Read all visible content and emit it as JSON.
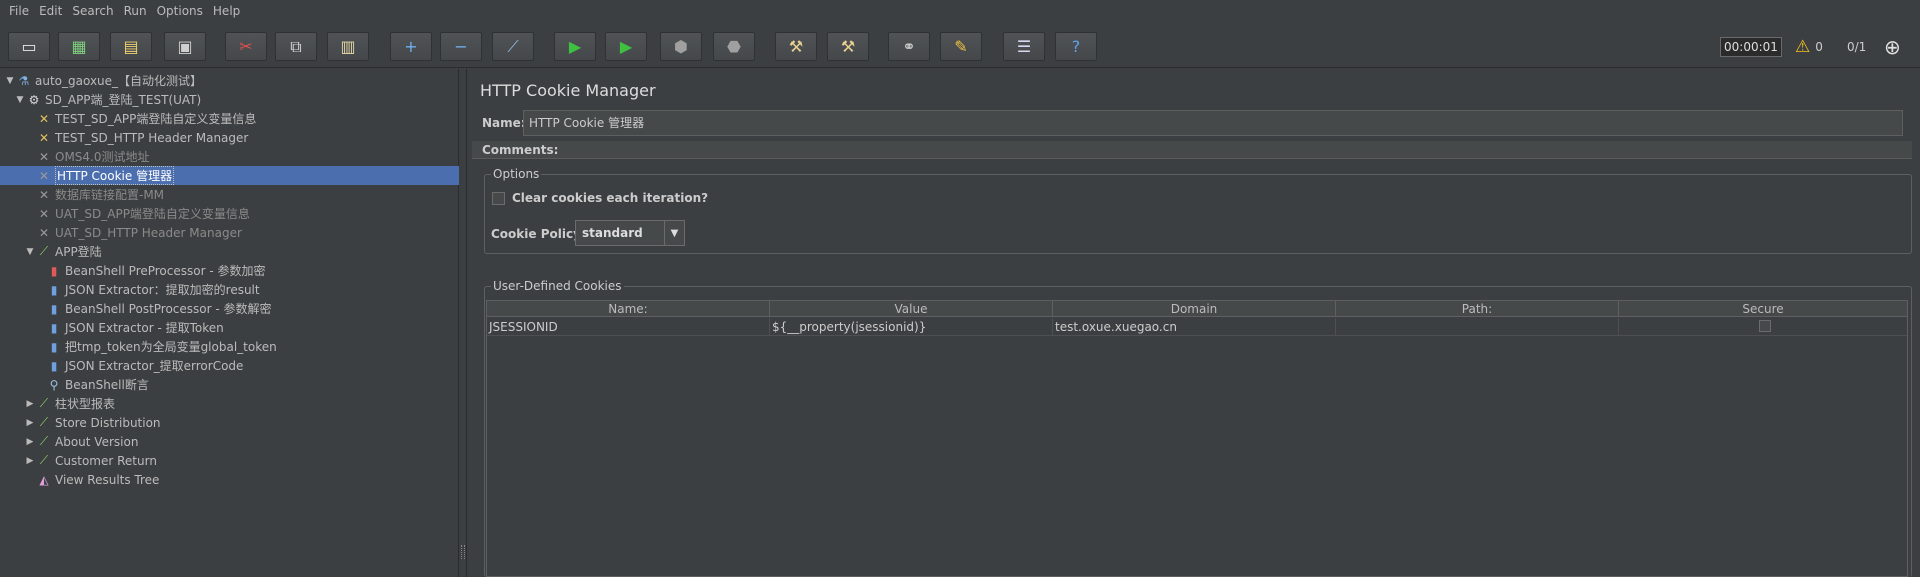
{
  "menu": [
    "File",
    "Edit",
    "Search",
    "Run",
    "Options",
    "Help"
  ],
  "toolbar": {
    "buttons": [
      {
        "name": "new-icon",
        "glyph": "▭"
      },
      {
        "name": "templates-icon",
        "glyph": "▦"
      },
      {
        "name": "open-icon",
        "glyph": "▤"
      },
      {
        "name": "save-icon",
        "glyph": "▣"
      },
      {
        "name": "cut-icon",
        "glyph": "✂"
      },
      {
        "name": "copy-icon",
        "glyph": "⧉"
      },
      {
        "name": "paste-icon",
        "glyph": "▥"
      },
      {
        "name": "expand-icon",
        "glyph": "+"
      },
      {
        "name": "collapse-icon",
        "glyph": "−"
      },
      {
        "name": "toggle-icon",
        "glyph": "⟋"
      },
      {
        "name": "start-icon",
        "glyph": "▶"
      },
      {
        "name": "start-no-pause-icon",
        "glyph": "▶"
      },
      {
        "name": "stop-icon",
        "glyph": "⬢"
      },
      {
        "name": "shutdown-icon",
        "glyph": "⬣"
      },
      {
        "name": "clear-icon",
        "glyph": "⚒"
      },
      {
        "name": "clear-all-icon",
        "glyph": "⚒"
      },
      {
        "name": "search-icon",
        "glyph": "⚭"
      },
      {
        "name": "reset-search-icon",
        "glyph": "✎"
      },
      {
        "name": "function-helper-icon",
        "glyph": "☰"
      },
      {
        "name": "help-icon",
        "glyph": "?"
      }
    ],
    "timer": "00:00:01",
    "warning_count": "0",
    "threads": "0/1"
  },
  "tree": [
    {
      "label": "auto_gaoxue_【自动化测试】",
      "level": 0,
      "toggle": "▼",
      "icon": "flask-icon",
      "glyph": "⚗",
      "color": "#7fb2e5",
      "state": "normal"
    },
    {
      "label": "SD_APP端_登陆_TEST(UAT)",
      "level": 1,
      "toggle": "▼",
      "icon": "thread-group-icon",
      "glyph": "⚙",
      "color": "#d9d9d9",
      "state": "normal"
    },
    {
      "label": "TEST_SD_APP端登陆自定义变量信息",
      "level": 2,
      "toggle": "",
      "icon": "config-icon",
      "glyph": "✕",
      "color": "#e0c060",
      "state": "normal"
    },
    {
      "label": "TEST_SD_HTTP Header Manager",
      "level": 2,
      "toggle": "",
      "icon": "config-icon",
      "glyph": "✕",
      "color": "#e0c060",
      "state": "normal"
    },
    {
      "label": "OMS4.0测试地址",
      "level": 2,
      "toggle": "",
      "icon": "config-icon",
      "glyph": "✕",
      "color": "#9a9a9a",
      "state": "disabled"
    },
    {
      "label": "HTTP Cookie 管理器",
      "level": 2,
      "toggle": "",
      "icon": "config-icon",
      "glyph": "✕",
      "color": "#9a9a9a",
      "state": "selected"
    },
    {
      "label": "数据库链接配置-MM",
      "level": 2,
      "toggle": "",
      "icon": "config-icon",
      "glyph": "✕",
      "color": "#9a9a9a",
      "state": "disabled"
    },
    {
      "label": "UAT_SD_APP端登陆自定义变量信息",
      "level": 2,
      "toggle": "",
      "icon": "config-icon",
      "glyph": "✕",
      "color": "#9a9a9a",
      "state": "disabled"
    },
    {
      "label": "UAT_SD_HTTP Header Manager",
      "level": 2,
      "toggle": "",
      "icon": "config-icon",
      "glyph": "✕",
      "color": "#9a9a9a",
      "state": "disabled"
    },
    {
      "label": "APP登陆",
      "level": 2,
      "toggle": "▼",
      "icon": "sampler-icon",
      "glyph": "⟋",
      "color": "#8fd16a",
      "state": "normal"
    },
    {
      "label": "BeanShell PreProcessor - 参数加密",
      "level": 3,
      "toggle": "",
      "icon": "preprocessor-icon",
      "glyph": "▮",
      "color": "#e05a5a",
      "state": "normal"
    },
    {
      "label": "JSON Extractor：提取加密的result",
      "level": 3,
      "toggle": "",
      "icon": "postprocessor-icon",
      "glyph": "▮",
      "color": "#6fa0e0",
      "state": "normal"
    },
    {
      "label": "BeanShell PostProcessor - 参数解密",
      "level": 3,
      "toggle": "",
      "icon": "postprocessor-icon",
      "glyph": "▮",
      "color": "#6fa0e0",
      "state": "normal"
    },
    {
      "label": "JSON Extractor - 提取Token",
      "level": 3,
      "toggle": "",
      "icon": "postprocessor-icon",
      "glyph": "▮",
      "color": "#6fa0e0",
      "state": "normal"
    },
    {
      "label": "把tmp_token为全局变量global_token",
      "level": 3,
      "toggle": "",
      "icon": "postprocessor-icon",
      "glyph": "▮",
      "color": "#6fa0e0",
      "state": "normal"
    },
    {
      "label": "JSON Extractor_提取errorCode",
      "level": 3,
      "toggle": "",
      "icon": "postprocessor-icon",
      "glyph": "▮",
      "color": "#6fa0e0",
      "state": "normal"
    },
    {
      "label": "BeanShell断言",
      "level": 3,
      "toggle": "",
      "icon": "assertion-icon",
      "glyph": "⚲",
      "color": "#a0c0e0",
      "state": "normal"
    },
    {
      "label": "柱状型报表",
      "level": 2,
      "toggle": "▶",
      "icon": "sampler-icon",
      "glyph": "⟋",
      "color": "#8fd16a",
      "state": "normal"
    },
    {
      "label": "Store Distribution",
      "level": 2,
      "toggle": "▶",
      "icon": "sampler-icon",
      "glyph": "⟋",
      "color": "#8fd16a",
      "state": "normal"
    },
    {
      "label": "About Version",
      "level": 2,
      "toggle": "▶",
      "icon": "sampler-icon",
      "glyph": "⟋",
      "color": "#8fd16a",
      "state": "normal"
    },
    {
      "label": "Customer Return",
      "level": 2,
      "toggle": "▶",
      "icon": "sampler-icon",
      "glyph": "⟋",
      "color": "#8fd16a",
      "state": "normal"
    },
    {
      "label": "View Results Tree",
      "level": 2,
      "toggle": "",
      "icon": "listener-icon",
      "glyph": "◭",
      "color": "#e0a0e0",
      "state": "normal"
    }
  ],
  "panel": {
    "title": "HTTP Cookie Manager",
    "name_label": "Name:",
    "name_value": "HTTP Cookie 管理器",
    "comments_label": "Comments:",
    "options_title": "Options",
    "clear_cookies_label": "Clear cookies each iteration?",
    "cookie_policy_label": "Cookie Policy:",
    "cookie_policy_value": "standard",
    "cookies_title": "User-Defined Cookies",
    "table": {
      "headers": [
        "Name:",
        "Value",
        "Domain",
        "Path:",
        "Secure"
      ],
      "rows": [
        [
          "JSESSIONID",
          "${__property(jsessionid)}",
          "test.oxue.xuegao.cn",
          "",
          ""
        ]
      ]
    }
  }
}
